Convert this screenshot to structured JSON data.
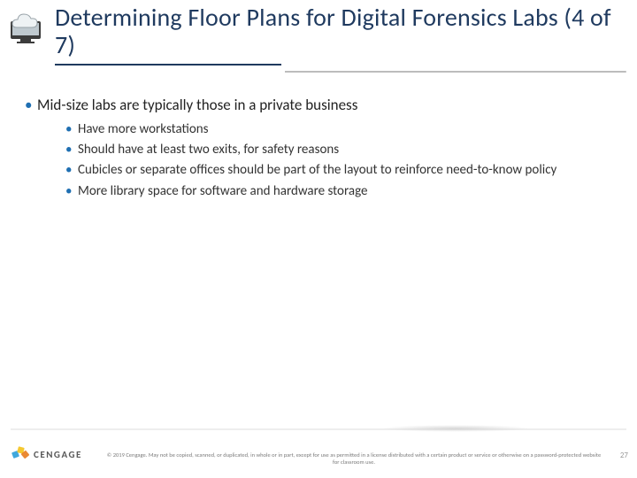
{
  "title": "Determining Floor Plans for Digital Forensics Labs (4 of 7)",
  "bullets": {
    "lvl1": "Mid-size labs are typically those in a private business",
    "lvl2": [
      "Have more workstations",
      "Should have at least two exits, for safety reasons",
      "Cubicles or separate offices should be part of the layout to reinforce need-to-know policy",
      "More library space for software and hardware storage"
    ]
  },
  "footer": {
    "brand": "CENGAGE",
    "copyright": "© 2019 Cengage. May not be copied, scanned, or duplicated, in whole or in part, except for use as permitted in a license distributed with a certain product or service or otherwise on a password-protected website for classroom use."
  },
  "page_number": "27",
  "icons": {
    "header": "cloud-monitor-icon"
  }
}
